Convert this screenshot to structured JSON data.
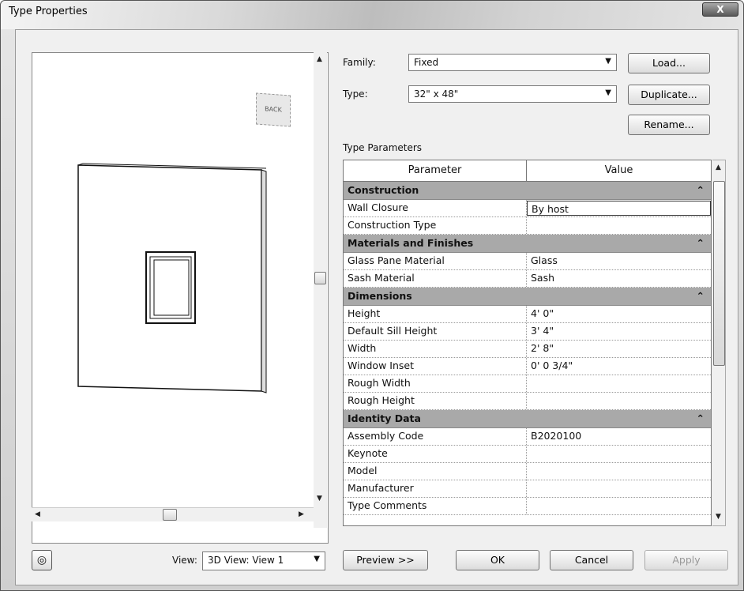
{
  "window": {
    "title": "Type Properties",
    "close_glyph": "X"
  },
  "preview": {
    "viewcube_label": "BACK",
    "view_label": "View:",
    "view_value": "3D View: View 1",
    "preview_button": "Preview >>"
  },
  "family": {
    "label": "Family:",
    "value": "Fixed",
    "load_button": "Load..."
  },
  "type": {
    "label": "Type:",
    "value": "32\" x 48\"",
    "duplicate_button": "Duplicate...",
    "rename_button": "Rename..."
  },
  "type_parameters_label": "Type Parameters",
  "table": {
    "col_parameter": "Parameter",
    "col_value": "Value",
    "groups": [
      {
        "name": "Construction",
        "rows": [
          {
            "p": "Wall Closure",
            "v": "By host"
          },
          {
            "p": "Construction Type",
            "v": ""
          }
        ]
      },
      {
        "name": "Materials and Finishes",
        "rows": [
          {
            "p": "Glass Pane Material",
            "v": "Glass"
          },
          {
            "p": "Sash Material",
            "v": "Sash"
          }
        ]
      },
      {
        "name": "Dimensions",
        "rows": [
          {
            "p": "Height",
            "v": "4'  0\""
          },
          {
            "p": "Default Sill Height",
            "v": "3'  4\""
          },
          {
            "p": "Width",
            "v": "2'  8\""
          },
          {
            "p": "Window Inset",
            "v": "0'  0 3/4\""
          },
          {
            "p": "Rough Width",
            "v": ""
          },
          {
            "p": "Rough Height",
            "v": ""
          }
        ]
      },
      {
        "name": "Identity Data",
        "rows": [
          {
            "p": "Assembly Code",
            "v": "B2020100"
          },
          {
            "p": "Keynote",
            "v": ""
          },
          {
            "p": "Model",
            "v": ""
          },
          {
            "p": "Manufacturer",
            "v": ""
          },
          {
            "p": "Type Comments",
            "v": ""
          }
        ]
      }
    ]
  },
  "buttons": {
    "ok": "OK",
    "cancel": "Cancel",
    "apply": "Apply"
  }
}
